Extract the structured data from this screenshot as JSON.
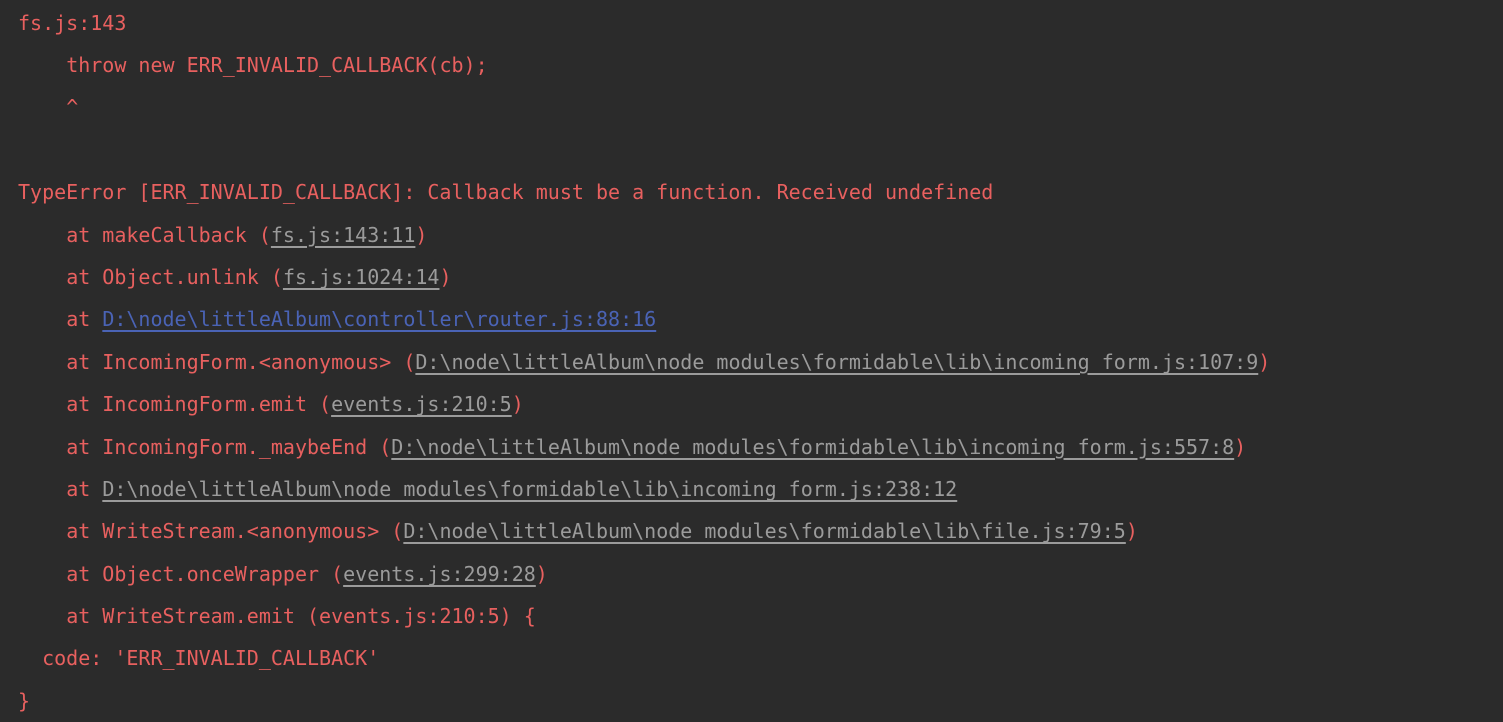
{
  "terminal": {
    "title": "node-error-stack-trace",
    "background_color": "#2b2b2b",
    "error_color": "#e8605f",
    "muted_color": "#9b9b9b",
    "link_color": "#4a63b5"
  },
  "lines": [
    {
      "id": "line-1",
      "indent": 0,
      "segments": [
        {
          "style": "err",
          "text": "fs.js:143"
        }
      ]
    },
    {
      "id": "line-2",
      "indent": 4,
      "segments": [
        {
          "style": "err",
          "text": "throw new ERR_INVALID_CALLBACK(cb);"
        }
      ]
    },
    {
      "id": "line-3",
      "indent": 4,
      "segments": [
        {
          "style": "err",
          "text": "^"
        }
      ]
    },
    {
      "id": "line-4",
      "indent": 0,
      "segments": [
        {
          "style": "blank",
          "text": " "
        }
      ]
    },
    {
      "id": "line-5",
      "indent": 0,
      "segments": [
        {
          "style": "err",
          "text": "TypeError [ERR_INVALID_CALLBACK]: Callback must be a function. Received undefined"
        }
      ]
    },
    {
      "id": "line-6",
      "indent": 4,
      "segments": [
        {
          "style": "err",
          "text": "at makeCallback ("
        },
        {
          "style": "muted",
          "text": "fs.js:143:11"
        },
        {
          "style": "err",
          "text": ")"
        }
      ]
    },
    {
      "id": "line-7",
      "indent": 4,
      "segments": [
        {
          "style": "err",
          "text": "at Object.unlink ("
        },
        {
          "style": "muted",
          "text": "fs.js:1024:14"
        },
        {
          "style": "err",
          "text": ")"
        }
      ]
    },
    {
      "id": "line-8",
      "indent": 4,
      "segments": [
        {
          "style": "err",
          "text": "at "
        },
        {
          "style": "link",
          "text": "D:\\node\\littleAlbum\\controller\\router.js:88:16"
        }
      ]
    },
    {
      "id": "line-9",
      "indent": 4,
      "segments": [
        {
          "style": "err",
          "text": "at IncomingForm.<anonymous> ("
        },
        {
          "style": "muted",
          "text": "D:\\node\\littleAlbum\\node_modules\\formidable\\lib\\incoming_form.js:107:9"
        },
        {
          "style": "err",
          "text": ")"
        }
      ]
    },
    {
      "id": "line-10",
      "indent": 4,
      "segments": [
        {
          "style": "err",
          "text": "at IncomingForm.emit ("
        },
        {
          "style": "muted",
          "text": "events.js:210:5"
        },
        {
          "style": "err",
          "text": ")"
        }
      ]
    },
    {
      "id": "line-11",
      "indent": 4,
      "segments": [
        {
          "style": "err",
          "text": "at IncomingForm._maybeEnd ("
        },
        {
          "style": "muted",
          "text": "D:\\node\\littleAlbum\\node_modules\\formidable\\lib\\incoming_form.js:557:8"
        },
        {
          "style": "err",
          "text": ")"
        }
      ]
    },
    {
      "id": "line-12",
      "indent": 4,
      "segments": [
        {
          "style": "err",
          "text": "at "
        },
        {
          "style": "muted",
          "text": "D:\\node\\littleAlbum\\node_modules\\formidable\\lib\\incoming_form.js:238:12"
        }
      ]
    },
    {
      "id": "line-13",
      "indent": 4,
      "segments": [
        {
          "style": "err",
          "text": "at WriteStream.<anonymous> ("
        },
        {
          "style": "muted",
          "text": "D:\\node\\littleAlbum\\node_modules\\formidable\\lib\\file.js:79:5"
        },
        {
          "style": "err",
          "text": ")"
        }
      ]
    },
    {
      "id": "line-14",
      "indent": 4,
      "segments": [
        {
          "style": "err",
          "text": "at Object.onceWrapper ("
        },
        {
          "style": "muted",
          "text": "events.js:299:28"
        },
        {
          "style": "err",
          "text": ")"
        }
      ]
    },
    {
      "id": "line-15",
      "indent": 4,
      "segments": [
        {
          "style": "err",
          "text": "at WriteStream.emit (events.js:210:5) {"
        }
      ]
    },
    {
      "id": "line-16",
      "indent": 2,
      "segments": [
        {
          "style": "err",
          "text": "code: 'ERR_INVALID_CALLBACK'"
        }
      ]
    },
    {
      "id": "line-17",
      "indent": 0,
      "segments": [
        {
          "style": "err",
          "text": "}"
        }
      ]
    }
  ]
}
